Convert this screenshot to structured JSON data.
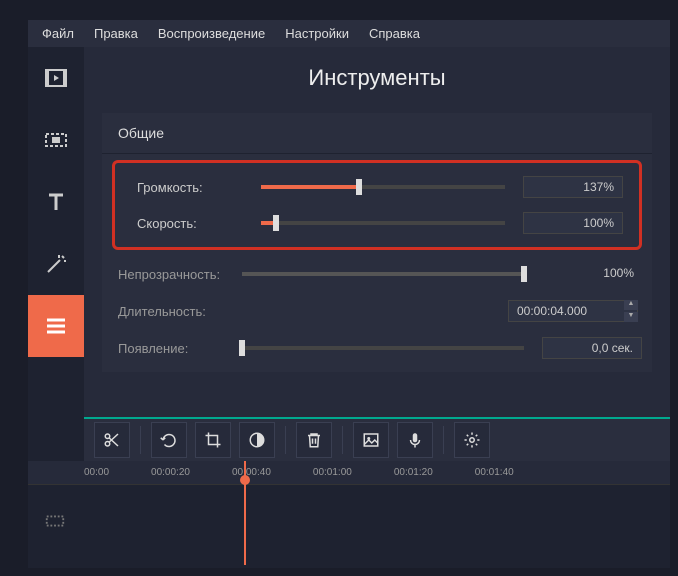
{
  "menu": {
    "file": "Файл",
    "edit": "Правка",
    "playback": "Воспроизведение",
    "settings": "Настройки",
    "help": "Справка"
  },
  "panel": {
    "title": "Инструменты",
    "section": "Общие"
  },
  "props": {
    "volume_label": "Громкость:",
    "volume_value": "137%",
    "volume_fill": 40,
    "speed_label": "Скорость:",
    "speed_value": "100%",
    "speed_fill": 6,
    "opacity_label": "Непрозрачность:",
    "opacity_value": "100%",
    "opacity_fill": 100,
    "duration_label": "Длительность:",
    "duration_value": "00:00:04.000",
    "appear_label": "Появление:",
    "appear_value": "0,0 сек.",
    "appear_fill": 0
  },
  "timeline": {
    "t0": "00:00",
    "t1": "00:00:20",
    "t2": "00:00:40",
    "t3": "00:01:00",
    "t4": "00:01:20",
    "t5": "00:01:40"
  }
}
